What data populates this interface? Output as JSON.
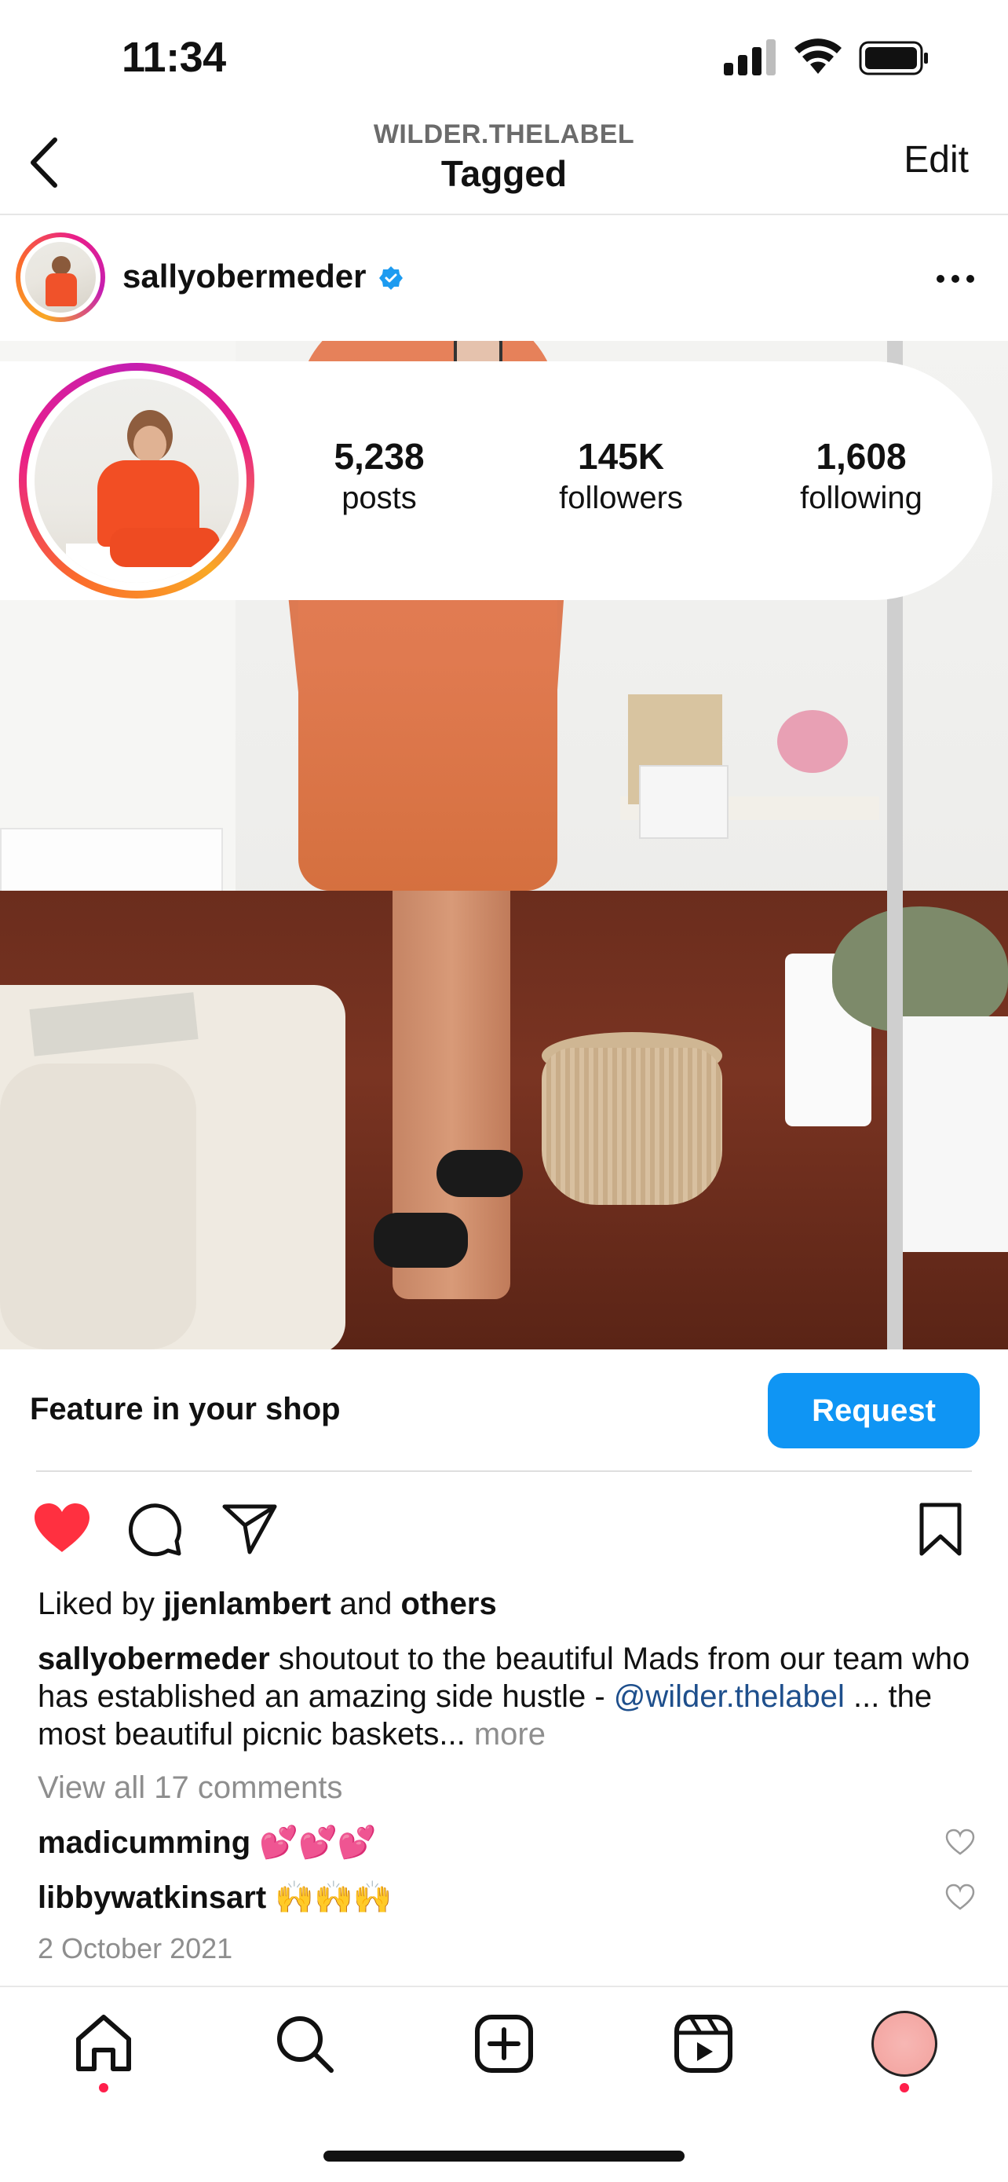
{
  "status_bar": {
    "time": "11:34"
  },
  "nav": {
    "subtitle": "WILDER.THELABEL",
    "title": "Tagged",
    "edit_label": "Edit"
  },
  "post": {
    "username": "sallyobermeder",
    "profile_card": {
      "posts_count": "5,238",
      "posts_label": "posts",
      "followers_count": "145K",
      "followers_label": "followers",
      "following_count": "1,608",
      "following_label": "following"
    },
    "feature_text": "Feature in your shop",
    "request_label": "Request",
    "liked_by_prefix": "Liked by ",
    "liked_by_user": "jjenlambert",
    "liked_by_middle": " and ",
    "liked_by_others": "others",
    "caption_user": "sallyobermeder",
    "caption_text": " shoutout to the beautiful Mads from our team who has established an amazing side hustle - ",
    "caption_mention": "@wilder.thelabel",
    "caption_tail": " ... the most beautiful picnic baskets... ",
    "caption_more": "more",
    "view_all_comments": "View all 17 comments",
    "comments": [
      {
        "user": "madicumming",
        "text": " 💕💕💕"
      },
      {
        "user": "libbywatkinsart",
        "text": " 🙌🙌🙌"
      }
    ],
    "date": "2 October 2021"
  },
  "icons": {
    "back": "chevron-left-icon",
    "verified": "verified-badge-icon",
    "more": "more-horizontal-icon",
    "like": "heart-filled-icon",
    "comment": "comment-icon",
    "share": "send-icon",
    "save": "bookmark-icon",
    "home": "home-icon",
    "search": "search-icon",
    "create": "plus-square-icon",
    "reels": "reels-icon"
  },
  "colors": {
    "like_red": "#ff3040",
    "request_blue": "#0f95f4",
    "mention_blue": "#1e4f8c",
    "notification_dot": "#ff1f4b"
  }
}
